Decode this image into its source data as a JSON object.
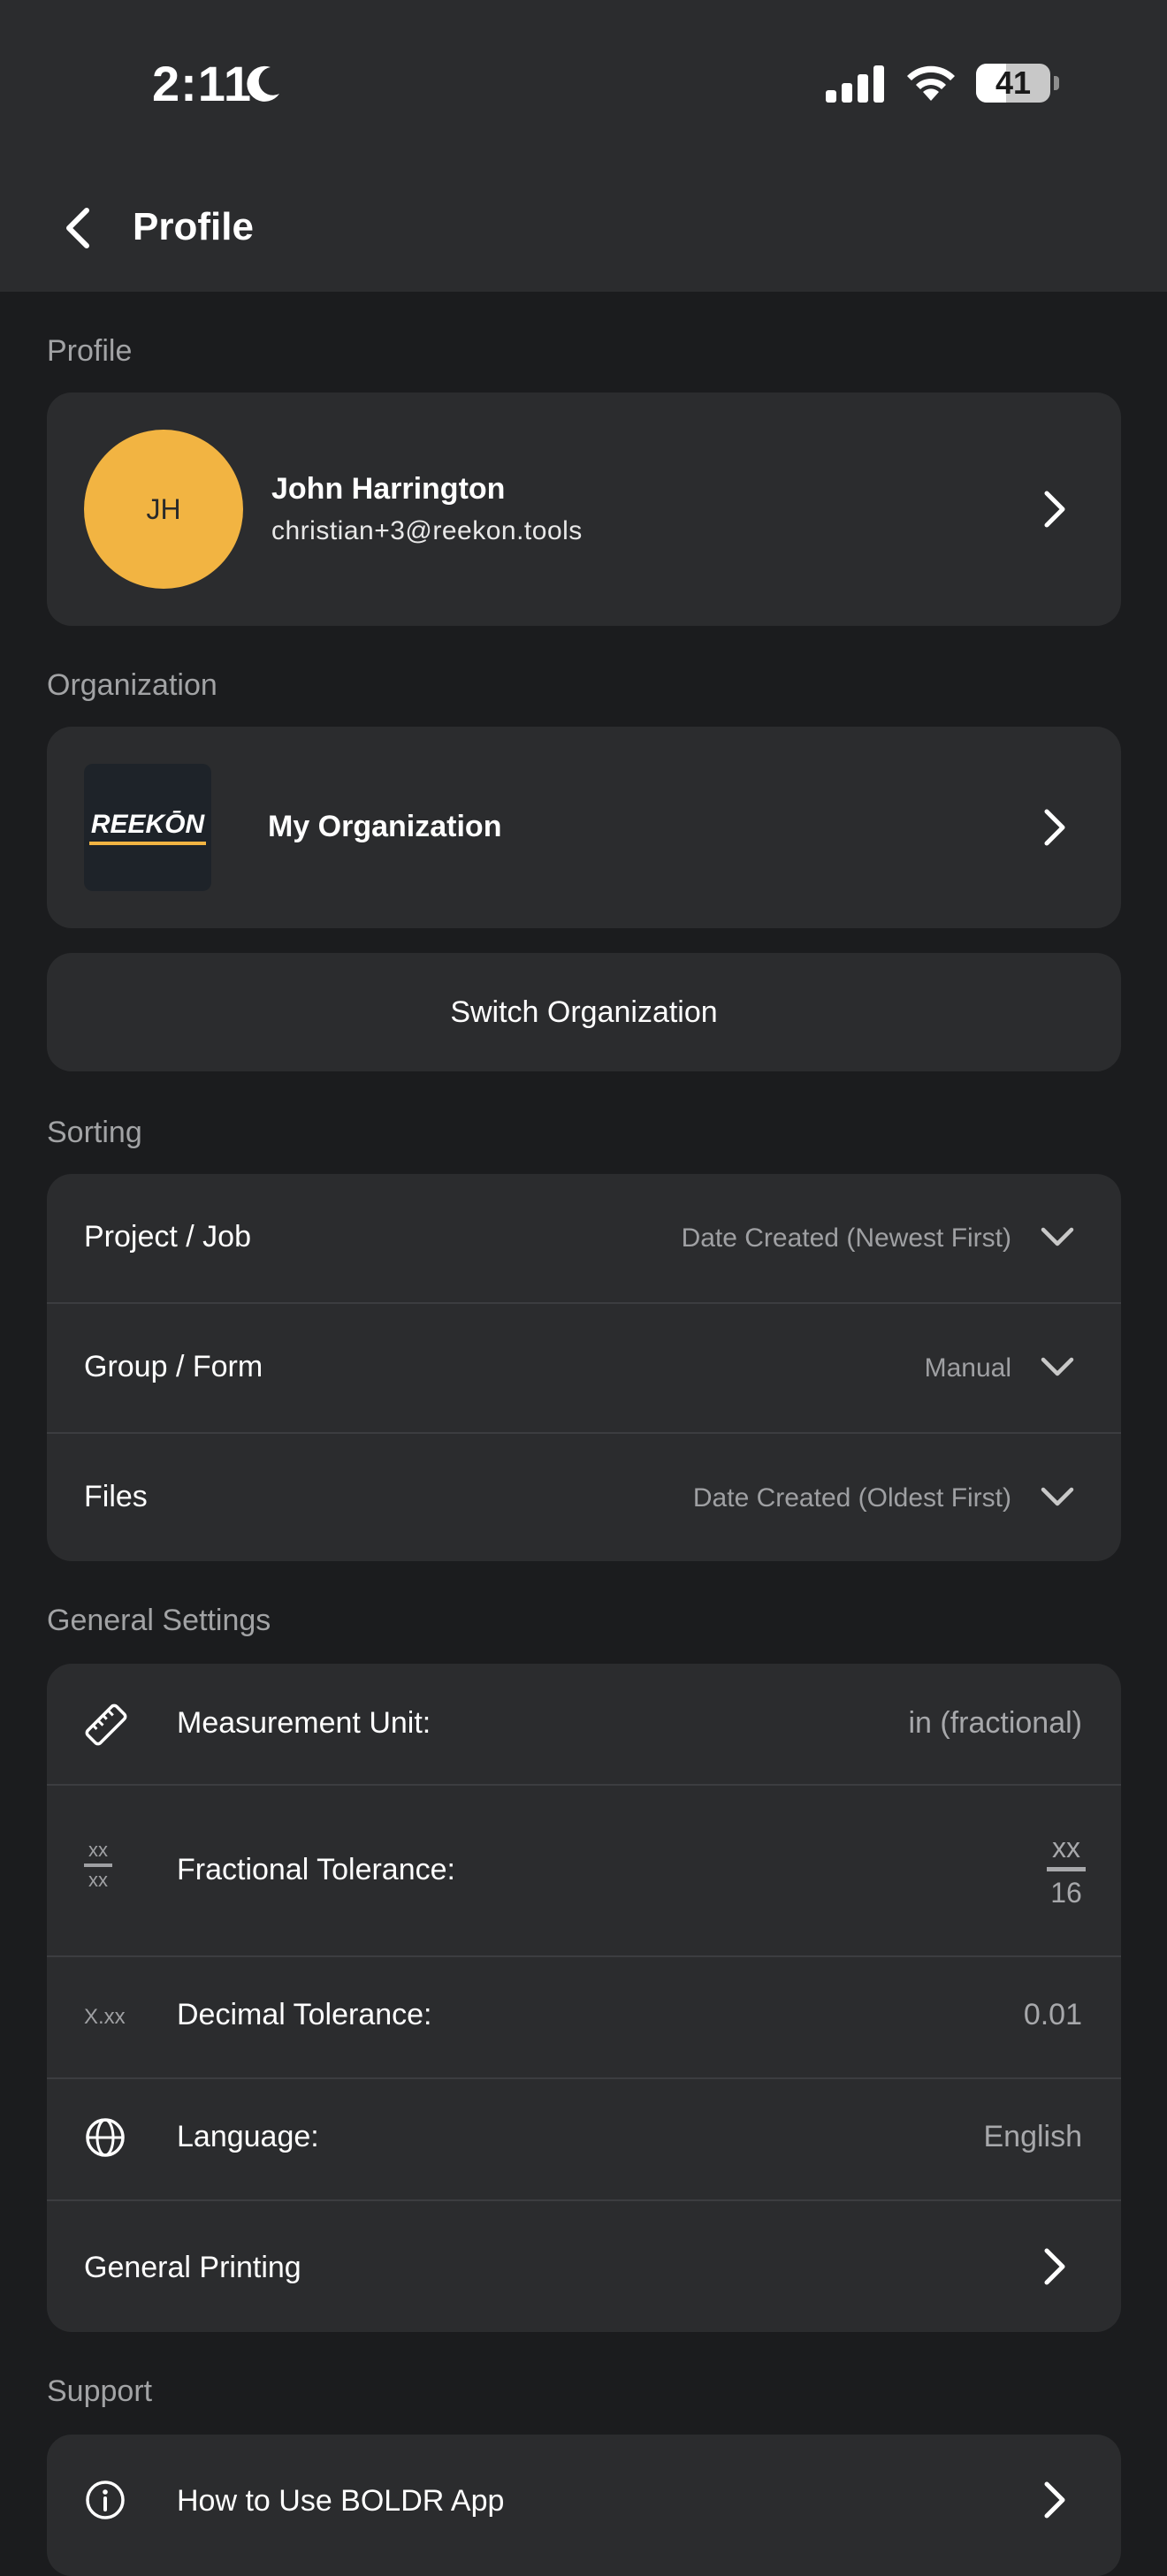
{
  "status": {
    "time": "2:11",
    "battery": "41",
    "battery_level_percent": 41
  },
  "nav": {
    "title": "Profile"
  },
  "profile_section": {
    "label": "Profile",
    "initials": "JH",
    "name": "John Harrington",
    "email": "christian+3@reekon.tools",
    "avatar_color": "#f2b442"
  },
  "organization_section": {
    "label": "Organization",
    "logo_text": "REEKŌN",
    "name": "My Organization",
    "switch_label": "Switch Organization"
  },
  "sorting_section": {
    "label": "Sorting",
    "rows": [
      {
        "label": "Project / Job",
        "value": "Date Created (Newest First)"
      },
      {
        "label": "Group / Form",
        "value": "Manual"
      },
      {
        "label": "Files",
        "value": "Date Created (Oldest First)"
      }
    ]
  },
  "general_settings": {
    "label": "General Settings",
    "measurement_unit": {
      "label": "Measurement Unit:",
      "value": "in (fractional)",
      "icon": "ruler-icon"
    },
    "fractional_tolerance": {
      "label": "Fractional Tolerance:",
      "numerator": "xx",
      "denominator": "16",
      "icon_top": "xx",
      "icon_bottom": "xx"
    },
    "decimal_tolerance": {
      "label": "Decimal Tolerance:",
      "value": "0.01",
      "icon_text": "X.xx"
    },
    "language": {
      "label": "Language:",
      "value": "English",
      "icon": "globe-icon"
    },
    "general_printing": {
      "label": "General Printing"
    }
  },
  "support_section": {
    "label": "Support",
    "rows": [
      {
        "label": "How to Use BOLDR App",
        "icon": "info-icon"
      }
    ]
  }
}
